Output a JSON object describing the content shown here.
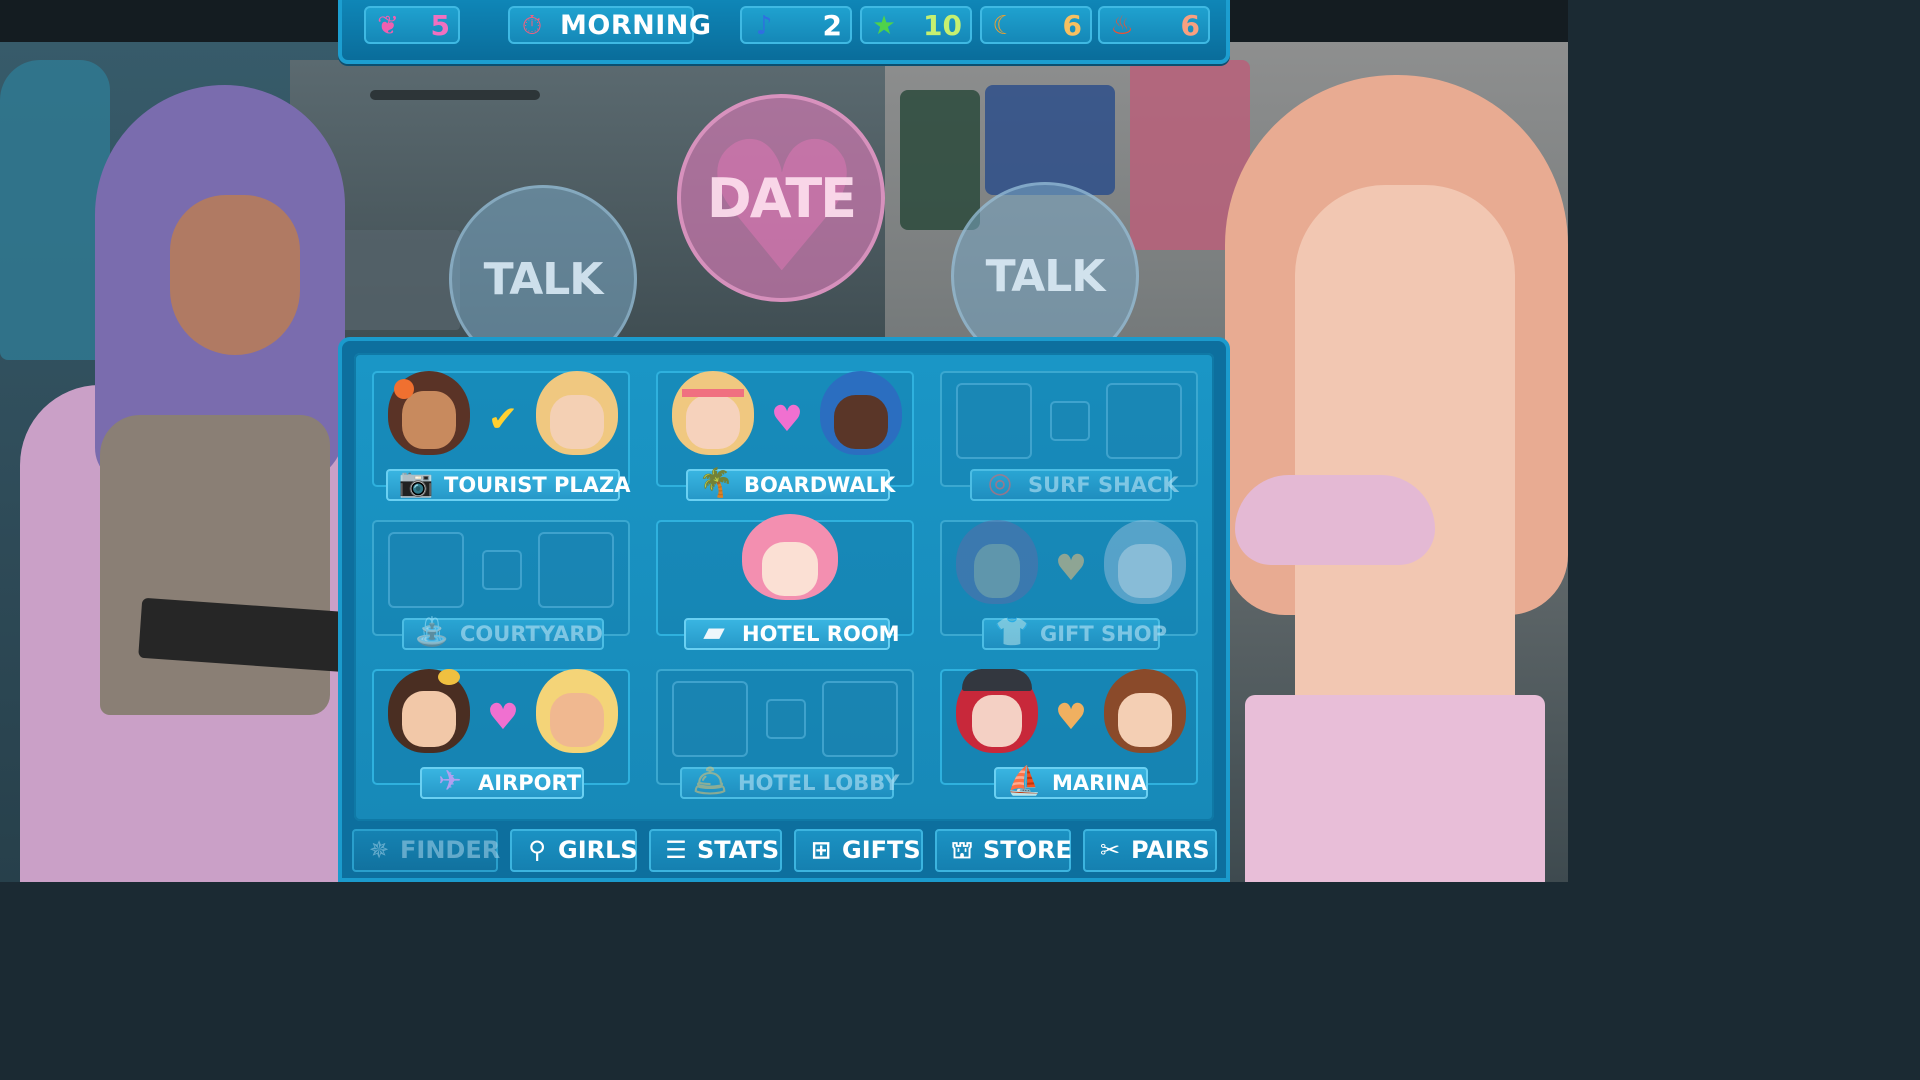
{
  "status_bar": {
    "butterflies": {
      "icon": "butterfly-icon",
      "value": "5",
      "color": "#f05fb0"
    },
    "time_of_day": {
      "icon": "stopwatch-icon",
      "label": "MORNING"
    },
    "music": {
      "icon": "music-note-icon",
      "value": "2",
      "color": "#2f6fe0"
    },
    "stars": {
      "icon": "star-icon",
      "value": "10",
      "color": "#4fd24a"
    },
    "moons": {
      "icon": "moon-icon",
      "value": "6",
      "color": "#f2a12a"
    },
    "flames": {
      "icon": "flame-icon",
      "value": "6",
      "color": "#f05030"
    }
  },
  "actions": {
    "talk_left": "TALK",
    "date": "DATE",
    "talk_right": "TALK"
  },
  "locations": [
    {
      "name": "TOURIST PLAZA",
      "icon": "camera-icon",
      "center": "checkmark-icon",
      "available": true
    },
    {
      "name": "BOARDWALK",
      "icon": "palm-tree-icon",
      "center": "exclamation-heart-icon",
      "available": true
    },
    {
      "name": "SURF SHACK",
      "icon": "life-ring-icon",
      "center": "",
      "available": false
    },
    {
      "name": "COURTYARD",
      "icon": "fountain-icon",
      "center": "",
      "available": false
    },
    {
      "name": "HOTEL ROOM",
      "icon": "pillow-icon",
      "center": "",
      "available": true
    },
    {
      "name": "GIFT SHOP",
      "icon": "shirt-icon",
      "center": "broken-heart-icon",
      "available": false
    },
    {
      "name": "AIRPORT",
      "icon": "airplane-icon",
      "center": "exclamation-heart-icon",
      "available": true
    },
    {
      "name": "HOTEL LOBBY",
      "icon": "service-bell-icon",
      "center": "",
      "available": false
    },
    {
      "name": "MARINA",
      "icon": "sailboat-icon",
      "center": "broken-heart-icon",
      "available": true
    }
  ],
  "tabs": [
    {
      "label": "FINDER",
      "icon": "compass-icon",
      "active": false
    },
    {
      "label": "GIRLS",
      "icon": "magnifier-icon",
      "active": true
    },
    {
      "label": "STATS",
      "icon": "bars-icon",
      "active": true
    },
    {
      "label": "GIFTS",
      "icon": "gift-icon",
      "active": true
    },
    {
      "label": "STORE",
      "icon": "bag-icon",
      "active": true
    },
    {
      "label": "PAIRS",
      "icon": "scissors-icon",
      "active": true
    }
  ]
}
